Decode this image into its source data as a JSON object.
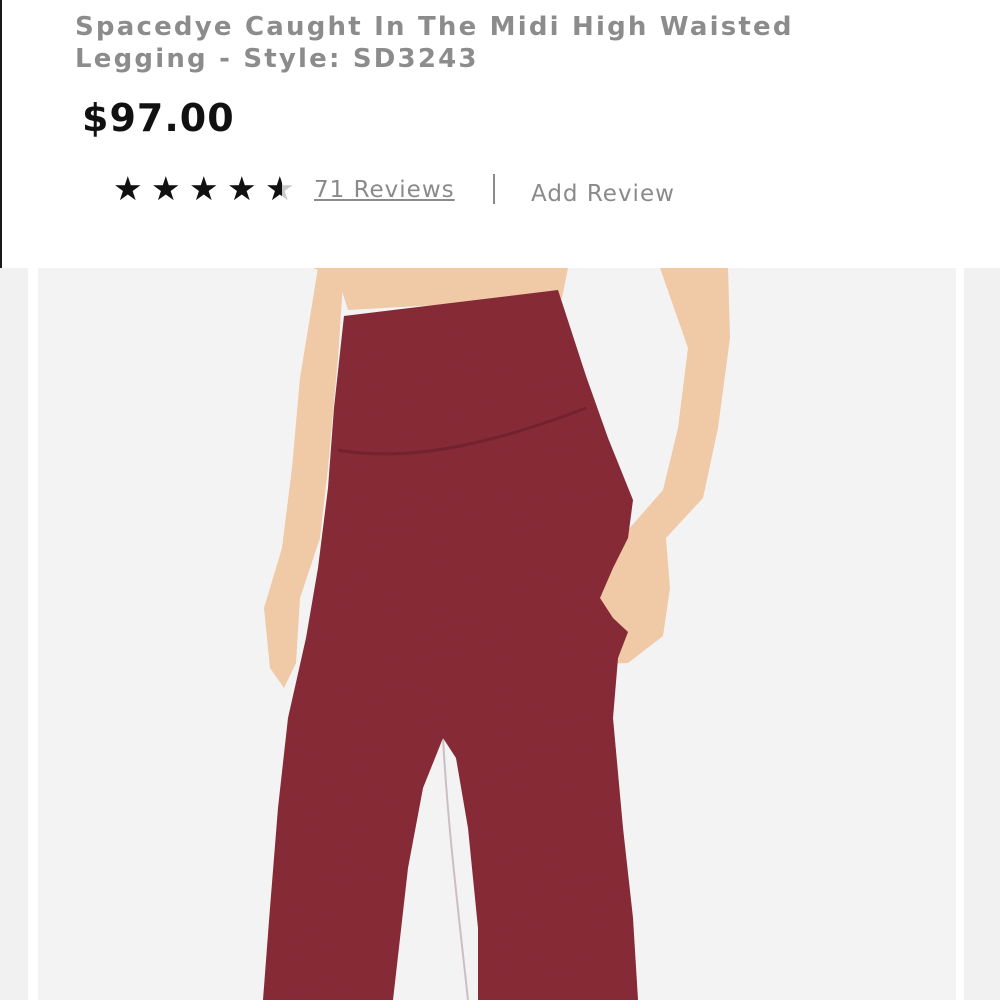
{
  "product": {
    "title": "Spacedye Caught In The Midi High Waisted Legging - Style: SD3243",
    "price": "$97.00",
    "rating": 4.5,
    "reviews_label": "71 Reviews",
    "add_review_label": "Add Review"
  },
  "colors": {
    "legging": "#8c2f3a",
    "skin": "#f0c9a6",
    "photo_background": "#f3f3f4"
  },
  "icons": {
    "star": "star-icon",
    "half_star": "half-star-icon"
  }
}
